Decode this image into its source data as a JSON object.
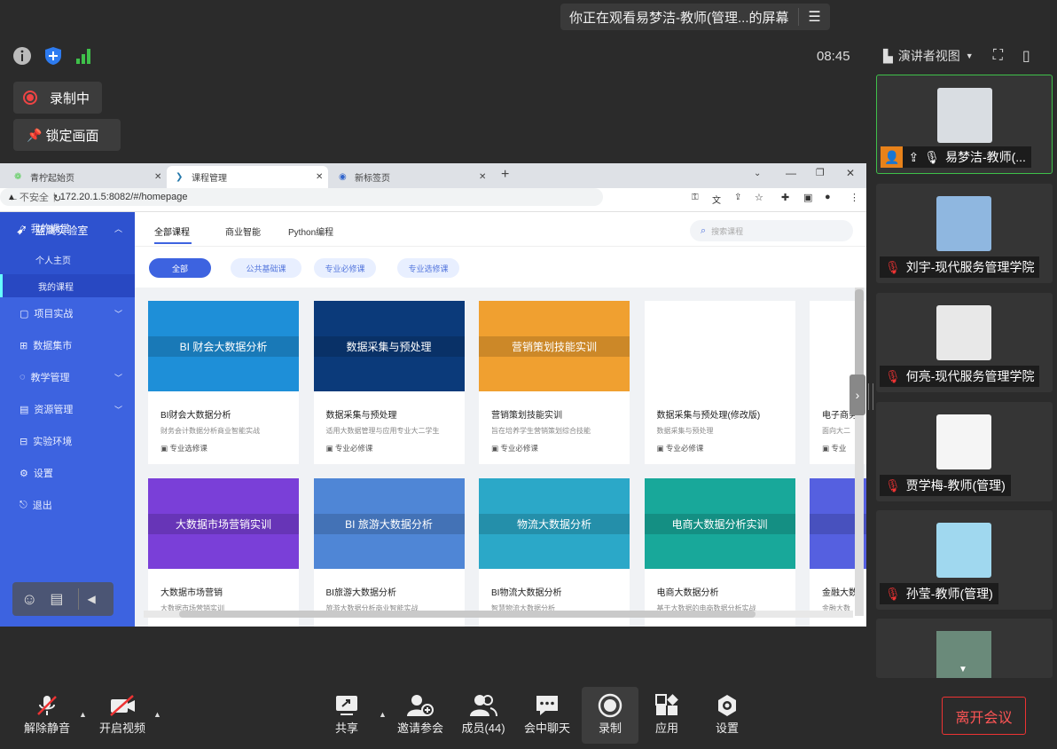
{
  "meeting": {
    "sharing_text": "你正在观看易梦洁-教师(管理...的屏幕",
    "clock": "08:45",
    "recording_label": "录制中",
    "lock_label": "锁定画面",
    "view_mode": "演讲者视图"
  },
  "browser": {
    "tabs": [
      {
        "label": "青柠起始页"
      },
      {
        "label": "课程管理"
      },
      {
        "label": "新标签页"
      }
    ],
    "insecure_label": "不安全",
    "url": "172.20.1.5:8082/#/homepage"
  },
  "app": {
    "brand": "蓝鹰实验室",
    "nav": [
      {
        "label": "我的课堂"
      },
      {
        "label": "个人主页"
      },
      {
        "label": "我的课程"
      },
      {
        "label": "项目实战"
      },
      {
        "label": "数据集市"
      },
      {
        "label": "教学管理"
      },
      {
        "label": "资源管理"
      },
      {
        "label": "实验环境"
      }
    ],
    "settings_label": "设置",
    "logout_label": "退出",
    "main_tabs": [
      {
        "label": "全部课程"
      },
      {
        "label": "商业智能"
      },
      {
        "label": "Python编程"
      }
    ],
    "search_placeholder": "搜索课程",
    "filters": [
      {
        "label": "全部"
      },
      {
        "label": "公共基础课"
      },
      {
        "label": "专业必修课"
      },
      {
        "label": "专业选修课"
      }
    ],
    "courses_row1": [
      {
        "img_title": "BI 财会大数据分析",
        "title": "BI财会大数据分析",
        "desc": "财务会计数据分析商业智能实战",
        "type": "专业选修课",
        "color": "#1e8fd8"
      },
      {
        "img_title": "数据采集与预处理",
        "title": "数据采集与预处理",
        "desc": "适用大数据管理与应用专业大二学生",
        "type": "专业必修课",
        "color": "#0b3a7a"
      },
      {
        "img_title": "营销策划技能实训",
        "title": "营销策划技能实训",
        "desc": "旨在培养学生营销策划综合技能",
        "type": "专业必修课",
        "color": "#f0a030"
      },
      {
        "img_title": "",
        "title": "数据采集与预处理(修改版)",
        "desc": "数据采集与预处理",
        "type": "专业必修课",
        "color": "#ffffff"
      },
      {
        "img_title": "",
        "title": "电子商务",
        "desc": "面向大二",
        "type": "专业",
        "color": "#ffffff"
      }
    ],
    "courses_row2": [
      {
        "img_title": "大数据市场营销实训",
        "title": "大数据市场营销",
        "desc": "大数据市场营销实训",
        "color": "#7a3fd8"
      },
      {
        "img_title": "BI 旅游大数据分析",
        "title": "BI旅游大数据分析",
        "desc": "旅游大数据分析商业智能实战",
        "color": "#4f86d6"
      },
      {
        "img_title": "物流大数据分析",
        "title": "BI物流大数据分析",
        "desc": "智慧物流大数据分析",
        "color": "#2ba8c8"
      },
      {
        "img_title": "电商大数据分析实训",
        "title": "电商大数据分析",
        "desc": "基于大数据的电商数据分析实战",
        "color": "#18a89a"
      },
      {
        "img_title": "BI 金",
        "title": "金融大数",
        "desc": "金融大数",
        "color": "#5560e0"
      }
    ]
  },
  "participants": [
    {
      "name": "易梦洁-教师(...",
      "avatar_color": "#d9dde2"
    },
    {
      "name": "刘宇-现代服务管理学院",
      "avatar_color": "#8fb7e0"
    },
    {
      "name": "何亮-现代服务管理学院",
      "avatar_color": "#e8e8e8"
    },
    {
      "name": "贾学梅-教师(管理)",
      "avatar_color": "#f5f5f5"
    },
    {
      "name": "孙莹-教师(管理)",
      "avatar_color": "#a0d8ef"
    }
  ],
  "toolbar": {
    "unmute": "解除静音",
    "video": "开启视频",
    "share": "共享",
    "invite": "邀请参会",
    "members": "成员(44)",
    "chat": "会中聊天",
    "record": "录制",
    "apps": "应用",
    "settings": "设置",
    "leave": "离开会议"
  }
}
